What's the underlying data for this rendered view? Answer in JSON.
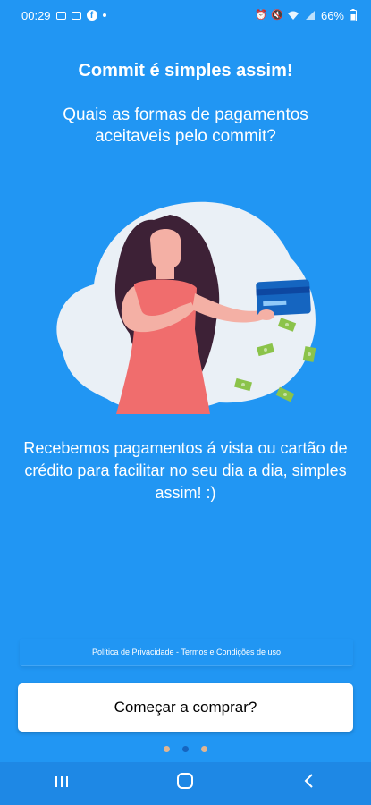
{
  "status_bar": {
    "time": "00:29",
    "battery": "66%",
    "left_icons": [
      "image-icon",
      "news-icon",
      "facebook-icon",
      "dot-icon"
    ],
    "right_icons": [
      "alarm-icon",
      "mute-icon",
      "wifi-icon",
      "signal-icon"
    ]
  },
  "onboarding": {
    "title": "Commit é simples assim!",
    "subtitle": "Quais as formas de pagamentos aceitaveis pelo commit?",
    "description": "Recebemos pagamentos á vista ou cartão de crédito para facilitar no seu dia a dia, simples assim! :)",
    "illustration": "woman-holding-credit-card-illustration"
  },
  "footer": {
    "privacy_label": "Política de Privacidade",
    "separator": " - ",
    "terms_label": "Termos e Condições de uso"
  },
  "primary_button": {
    "label": "Começar a comprar?"
  },
  "pager": {
    "current": 2,
    "total": 3,
    "active_color": "#1565C0",
    "inactive_color": "#E0B591"
  },
  "nav_bar": {
    "recents_icon": "recents-icon",
    "home_icon": "home-icon",
    "back_icon": "back-icon"
  },
  "colors": {
    "background": "#2196F3",
    "button_bg": "#FFFFFF",
    "nav_bar": "#1E88E5"
  }
}
